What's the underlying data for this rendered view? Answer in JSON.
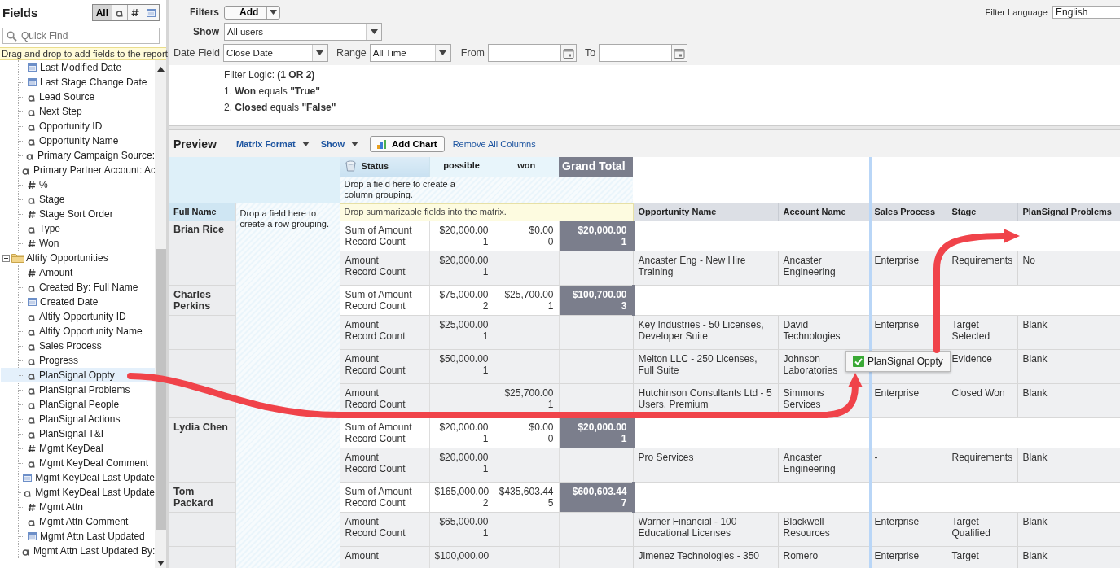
{
  "sidebar": {
    "title": "Fields",
    "type_filters": [
      {
        "kind": "all",
        "label": "All",
        "selected": true
      },
      {
        "kind": "text",
        "selected": false
      },
      {
        "kind": "number",
        "selected": false
      },
      {
        "kind": "date",
        "selected": false
      }
    ],
    "search": {
      "placeholder": "Quick Find"
    },
    "hint": "Drag and drop to add fields to the report.",
    "tree": [
      {
        "kind": "continued",
        "children": [
          {
            "kind": "date",
            "label": "Last Modified Date",
            "selected": false
          },
          {
            "kind": "date",
            "label": "Last Stage Change Date",
            "selected": false
          },
          {
            "kind": "text",
            "label": "Lead Source",
            "selected": false
          },
          {
            "kind": "text",
            "label": "Next Step",
            "selected": false
          },
          {
            "kind": "text",
            "label": "Opportunity ID",
            "selected": false
          },
          {
            "kind": "text",
            "label": "Opportunity Name",
            "selected": false
          },
          {
            "kind": "text",
            "label": "Primary Campaign Source:",
            "selected": false
          },
          {
            "kind": "text",
            "label": "Primary Partner Account: Ac",
            "selected": false
          },
          {
            "kind": "number",
            "label": "%",
            "selected": false
          },
          {
            "kind": "text",
            "label": "Stage",
            "selected": false
          },
          {
            "kind": "number",
            "label": "Stage Sort Order",
            "selected": false
          },
          {
            "kind": "text",
            "label": "Type",
            "selected": false
          },
          {
            "kind": "number",
            "label": "Won",
            "selected": false
          }
        ]
      },
      {
        "kind": "folder",
        "label": "Altify Opportunities",
        "expanded": true,
        "children": [
          {
            "kind": "number",
            "label": "Amount",
            "selected": false
          },
          {
            "kind": "text",
            "label": "Created By: Full Name",
            "selected": false
          },
          {
            "kind": "date",
            "label": "Created Date",
            "selected": false
          },
          {
            "kind": "text",
            "label": "Altify Opportunity ID",
            "selected": false
          },
          {
            "kind": "text",
            "label": "Altify Opportunity Name",
            "selected": false
          },
          {
            "kind": "text",
            "label": "Sales Process",
            "selected": false
          },
          {
            "kind": "text",
            "label": "Progress",
            "selected": false
          },
          {
            "kind": "text",
            "label": "PlanSignal Oppty",
            "selected": true
          },
          {
            "kind": "text",
            "label": "PlanSignal Problems",
            "selected": false
          },
          {
            "kind": "text",
            "label": "PlanSignal People",
            "selected": false
          },
          {
            "kind": "text",
            "label": "PlanSignal Actions",
            "selected": false
          },
          {
            "kind": "text",
            "label": "PlanSignal T&I",
            "selected": false
          },
          {
            "kind": "number",
            "label": "Mgmt KeyDeal",
            "selected": false
          },
          {
            "kind": "text",
            "label": "Mgmt KeyDeal Comment",
            "selected": false
          },
          {
            "kind": "date",
            "label": "Mgmt KeyDeal Last Update",
            "selected": false
          },
          {
            "kind": "text",
            "label": "Mgmt KeyDeal Last Update",
            "selected": false
          },
          {
            "kind": "number",
            "label": "Mgmt Attn",
            "selected": false
          },
          {
            "kind": "text",
            "label": "Mgmt Attn Comment",
            "selected": false
          },
          {
            "kind": "date",
            "label": "Mgmt Attn Last Updated",
            "selected": false
          },
          {
            "kind": "text",
            "label": "Mgmt Attn Last Updated By:",
            "selected": false
          }
        ]
      }
    ]
  },
  "filters": {
    "label": "Filters",
    "add_button": "Add",
    "show_label": "Show",
    "show_value": "All users",
    "date_field_label": "Date Field",
    "date_field_value": "Close Date",
    "range_label": "Range",
    "range_value": "All Time",
    "from_label": "From",
    "to_label": "To",
    "language_label": "Filter Language",
    "language_value": "English",
    "logic_label": "Filter Logic:",
    "logic_value": "(1 OR 2)",
    "conditions": [
      "1. **Won** equals **\"True\"**",
      "2. **Closed** equals **\"False\"**"
    ]
  },
  "preview": {
    "title": "Preview",
    "format_menu": "Matrix Format",
    "show_menu": "Show",
    "add_chart": "Add Chart",
    "remove_columns": "Remove All Columns"
  },
  "matrix": {
    "column_field": "Status",
    "column_values": [
      "possible",
      "won"
    ],
    "grand_total": "Grand Total",
    "column_drop_hint": "Drop a field here to create a column grouping.",
    "row_field": "Full Name",
    "row_drop_hint": "Drop a field here to create a row grouping.",
    "summary_drop_hint": "Drop summarizable fields into the matrix.",
    "detail_columns": [
      "Opportunity Name",
      "Account Name",
      "Sales Process",
      "Stage",
      "PlanSignal Problems"
    ],
    "rows": [
      {
        "kind": "summary",
        "name": "Brian Rice",
        "measures": [
          "Sum of Amount",
          "Record Count"
        ],
        "possible": [
          "$20,000.00",
          "1"
        ],
        "won": [
          "$0.00",
          "0"
        ],
        "grand_total": [
          "$20,000.00",
          "1"
        ]
      },
      {
        "kind": "detail",
        "measures": [
          "Amount",
          "Record Count"
        ],
        "possible": [
          "$20,000.00",
          "1"
        ],
        "opportunity_name": "Ancaster Eng - New Hire Training",
        "account_name": "Ancaster Engineering",
        "sales_process": "Enterprise",
        "stage": "Requirements",
        "plansignal_problems": "No"
      },
      {
        "kind": "summary",
        "name": "Charles Perkins",
        "measures": [
          "Sum of Amount",
          "Record Count"
        ],
        "possible": [
          "$75,000.00",
          "2"
        ],
        "won": [
          "$25,700.00",
          "1"
        ],
        "grand_total": [
          "$100,700.00",
          "3"
        ]
      },
      {
        "kind": "detail",
        "measures": [
          "Amount",
          "Record Count"
        ],
        "possible": [
          "$25,000.00",
          "1"
        ],
        "opportunity_name": "Key Industries - 50 Licenses, Developer Suite",
        "account_name": "David Technologies",
        "sales_process": "Enterprise",
        "stage": "Target Selected",
        "plansignal_problems": "Blank"
      },
      {
        "kind": "detail",
        "measures": [
          "Amount",
          "Record Count"
        ],
        "possible": [
          "$50,000.00",
          "1"
        ],
        "opportunity_name": "Melton LLC - 250 Licenses, Full Suite",
        "account_name": "Johnson Laboratories",
        "stage": "Evidence",
        "plansignal_problems": "Blank"
      },
      {
        "kind": "detail",
        "measures": [
          "Amount",
          "Record Count"
        ],
        "won": [
          "$25,700.00",
          "1"
        ],
        "opportunity_name": "Hutchinson Consultants Ltd - 5 Users, Premium",
        "account_name": "Simmons Services",
        "sales_process": "Enterprise",
        "stage": "Closed Won",
        "plansignal_problems": "Blank"
      },
      {
        "kind": "summary",
        "name": "Lydia Chen",
        "measures": [
          "Sum of Amount",
          "Record Count"
        ],
        "possible": [
          "$20,000.00",
          "1"
        ],
        "won": [
          "$0.00",
          "0"
        ],
        "grand_total": [
          "$20,000.00",
          "1"
        ]
      },
      {
        "kind": "detail",
        "measures": [
          "Amount",
          "Record Count"
        ],
        "possible": [
          "$20,000.00",
          "1"
        ],
        "opportunity_name": "Pro Services",
        "account_name": "Ancaster Engineering",
        "sales_process": "-",
        "stage": "Requirements",
        "plansignal_problems": "Blank"
      },
      {
        "kind": "summary",
        "name": "Tom Packard",
        "measures": [
          "Sum of Amount",
          "Record Count"
        ],
        "possible": [
          "$165,000.00",
          "2"
        ],
        "won": [
          "$435,603.44",
          "5"
        ],
        "grand_total": [
          "$600,603.44",
          "7"
        ]
      },
      {
        "kind": "detail",
        "measures": [
          "Amount",
          "Record Count"
        ],
        "possible": [
          "$65,000.00",
          "1"
        ],
        "opportunity_name": "Warner Financial - 100 Educational Licenses",
        "account_name": "Blackwell Resources",
        "sales_process": "Enterprise",
        "stage": "Target Qualified",
        "plansignal_problems": "Blank"
      },
      {
        "kind": "detail",
        "measures": [
          "Amount"
        ],
        "possible": [
          "$100,000.00"
        ],
        "opportunity_name": "Jimenez Technologies - 350",
        "account_name": "Romero",
        "sales_process": "Enterprise",
        "stage": "Target",
        "plansignal_problems": "Blank"
      }
    ]
  },
  "drag_tooltip": {
    "label": "PlanSignal Oppty"
  }
}
